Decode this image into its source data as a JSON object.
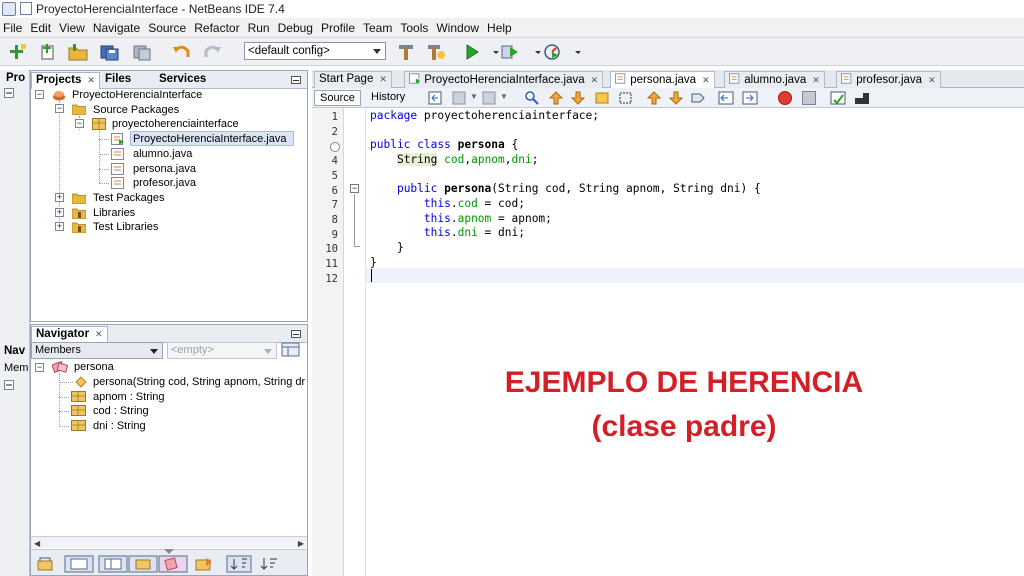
{
  "window": {
    "title": "ProyectoHerenciaInterface - NetBeans IDE 7.4"
  },
  "menu": [
    "File",
    "Edit",
    "View",
    "Navigate",
    "Source",
    "Refactor",
    "Run",
    "Debug",
    "Profile",
    "Team",
    "Tools",
    "Window",
    "Help"
  ],
  "toolbar": {
    "config": "<default config>"
  },
  "leftstrip": {
    "top_label": "Pro",
    "nav_label": "Nav",
    "members_label": "Mem"
  },
  "projects": {
    "tabs": [
      "Projects",
      "Files",
      "Services"
    ],
    "tree": [
      {
        "label": "ProyectoHerenciaInterface",
        "level": 0,
        "icon": "project-icon",
        "expanded": true
      },
      {
        "label": "Source Packages",
        "level": 1,
        "icon": "folder-icon",
        "expanded": true
      },
      {
        "label": "proyectoherenciainterface",
        "level": 2,
        "icon": "package-icon",
        "expanded": true
      },
      {
        "label": "ProyectoHerenciaInterface.java",
        "level": 3,
        "icon": "java-main-icon",
        "selected": true
      },
      {
        "label": "alumno.java",
        "level": 3,
        "icon": "java-file-icon"
      },
      {
        "label": "persona.java",
        "level": 3,
        "icon": "java-file-icon"
      },
      {
        "label": "profesor.java",
        "level": 3,
        "icon": "java-file-icon"
      },
      {
        "label": "Test Packages",
        "level": 1,
        "icon": "folder-icon",
        "expanded": false
      },
      {
        "label": "Libraries",
        "level": 1,
        "icon": "library-icon",
        "expanded": false
      },
      {
        "label": "Test Libraries",
        "level": 1,
        "icon": "library-icon",
        "expanded": false
      }
    ]
  },
  "navigator": {
    "title": "Navigator",
    "filter": "Members",
    "filter2": "<empty>",
    "tree": [
      {
        "label": "persona",
        "level": 0,
        "icon": "class-icon"
      },
      {
        "label": "persona(String cod, String apnom, String dr",
        "level": 1,
        "icon": "constructor-icon"
      },
      {
        "label": "apnom : String",
        "level": 1,
        "icon": "field-icon"
      },
      {
        "label": "cod : String",
        "level": 1,
        "icon": "field-icon"
      },
      {
        "label": "dni : String",
        "level": 1,
        "icon": "field-icon"
      }
    ]
  },
  "editor": {
    "tabs": [
      "Start Page",
      "ProyectoHerenciaInterface.java",
      "persona.java",
      "alumno.java",
      "profesor.java"
    ],
    "active_tab": "persona.java",
    "source_btn": "Source",
    "history_btn": "History",
    "line_numbers": [
      "1",
      "2",
      "3",
      "4",
      "5",
      "6",
      "7",
      "8",
      "9",
      "10",
      "11",
      "12"
    ],
    "lines": [
      "package proyectoherenciainterface;",
      "",
      "public class persona {",
      "    String cod,apnom,dni;",
      "",
      "    public persona(String cod, String apnom, String dni) {",
      "        this.cod = cod;",
      "        this.apnom = apnom;",
      "        this.dni = dni;",
      "    }",
      "}",
      ""
    ]
  },
  "overlay": {
    "line1": "EJEMPLO DE HERENCIA",
    "line2": "(clase padre)",
    "color": "#d41f26"
  }
}
